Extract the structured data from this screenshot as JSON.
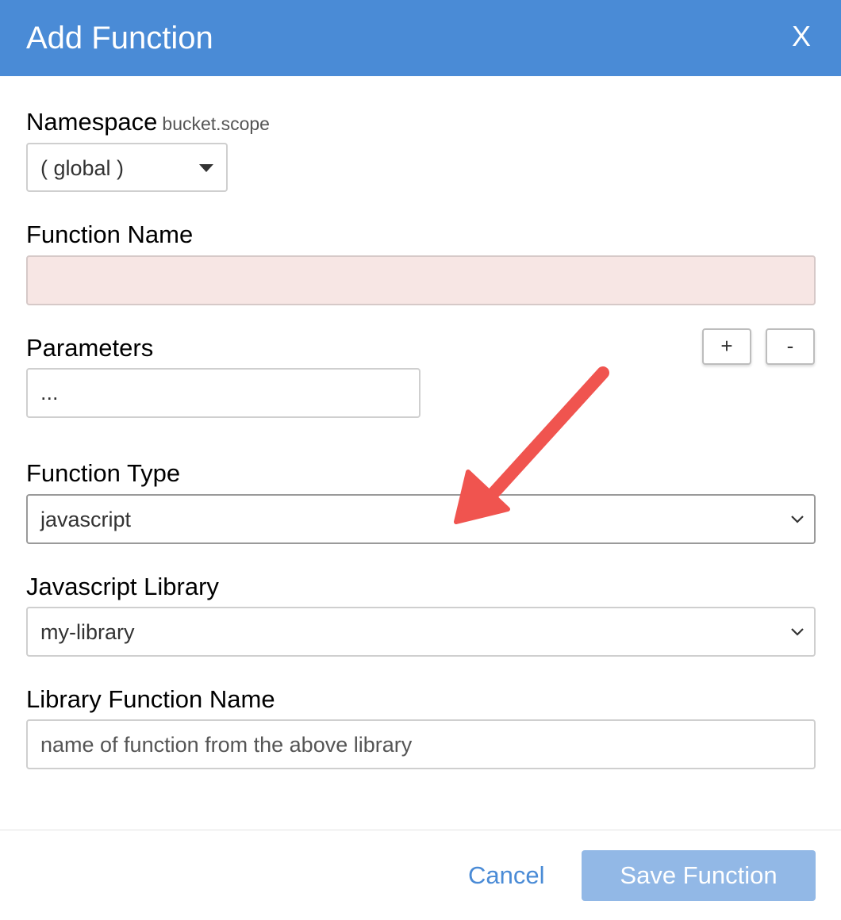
{
  "dialog": {
    "title": "Add Function",
    "close_label": "X"
  },
  "namespace": {
    "label": "Namespace",
    "hint": "bucket.scope",
    "selected": "( global )"
  },
  "function_name": {
    "label": "Function Name",
    "value": ""
  },
  "parameters": {
    "label": "Parameters",
    "value": "...",
    "add_label": "+",
    "remove_label": "-"
  },
  "function_type": {
    "label": "Function Type",
    "selected": "javascript"
  },
  "javascript_library": {
    "label": "Javascript Library",
    "selected": "my-library"
  },
  "library_function_name": {
    "label": "Library Function Name",
    "placeholder": "name of function from the above library"
  },
  "footer": {
    "cancel_label": "Cancel",
    "save_label": "Save Function"
  },
  "colors": {
    "header": "#4a8bd6",
    "invalid_field": "#f7e6e4",
    "save_disabled": "#92b8e6",
    "annotation_arrow": "#f0544f"
  }
}
